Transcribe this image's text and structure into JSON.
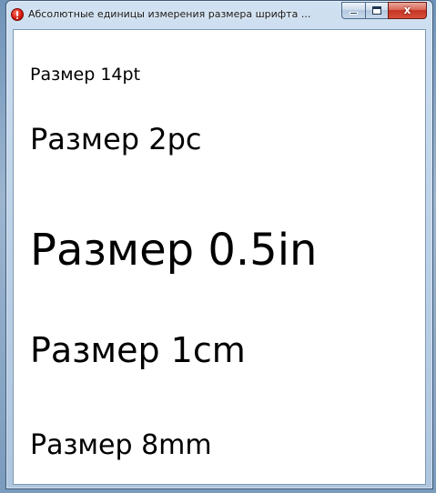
{
  "window": {
    "title": "Абсолютные единицы измерения размера шрифта ...",
    "close_glyph": "x"
  },
  "icons": {
    "app": "error-icon",
    "minimize": "minimize-icon",
    "maximize": "maximize-icon",
    "close": "close-icon"
  },
  "content": {
    "lines": [
      "Размер 14pt",
      "Размер 2pc",
      "Размер 0.5in",
      "Размер 1cm",
      "Размер 8mm"
    ]
  },
  "colors": {
    "close_button": "#c63322",
    "text": "#000000",
    "client_background": "#ffffff"
  }
}
